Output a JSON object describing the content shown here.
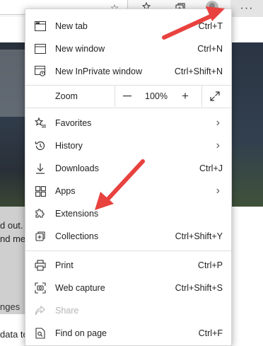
{
  "toolbar": {
    "favorite_icon": "star-outline-icon",
    "favorites_icon": "favorites-list-icon",
    "collections_icon": "collections-icon",
    "more_label": "···"
  },
  "page": {
    "snippets": [
      "d out.",
      "nd me",
      "nges",
      "data to"
    ]
  },
  "menu": {
    "items": [
      {
        "label": "New tab",
        "shortcut": "Ctrl+T",
        "icon": "new-tab-icon"
      },
      {
        "label": "New window",
        "shortcut": "Ctrl+N",
        "icon": "new-window-icon"
      },
      {
        "label": "New InPrivate window",
        "shortcut": "Ctrl+Shift+N",
        "icon": "inprivate-icon"
      }
    ],
    "zoom": {
      "label": "Zoom",
      "minus": "—",
      "value": "100%",
      "plus": "+"
    },
    "items2": [
      {
        "label": "Favorites",
        "icon": "favorites-icon"
      },
      {
        "label": "History",
        "icon": "history-icon"
      },
      {
        "label": "Downloads",
        "shortcut": "Ctrl+J",
        "icon": "download-icon"
      },
      {
        "label": "Apps",
        "icon": "apps-icon"
      },
      {
        "label": "Extensions",
        "icon": "extensions-icon"
      },
      {
        "label": "Collections",
        "shortcut": "Ctrl+Shift+Y",
        "icon": "collections-icon"
      }
    ],
    "items3": [
      {
        "label": "Print",
        "shortcut": "Ctrl+P",
        "icon": "print-icon"
      },
      {
        "label": "Web capture",
        "shortcut": "Ctrl+Shift+S",
        "icon": "web-capture-icon"
      },
      {
        "label": "Share",
        "icon": "share-icon"
      },
      {
        "label": "Find on page",
        "shortcut": "Ctrl+F",
        "icon": "find-icon"
      }
    ]
  },
  "annotation": {
    "arrow_color": "#e8423f"
  }
}
